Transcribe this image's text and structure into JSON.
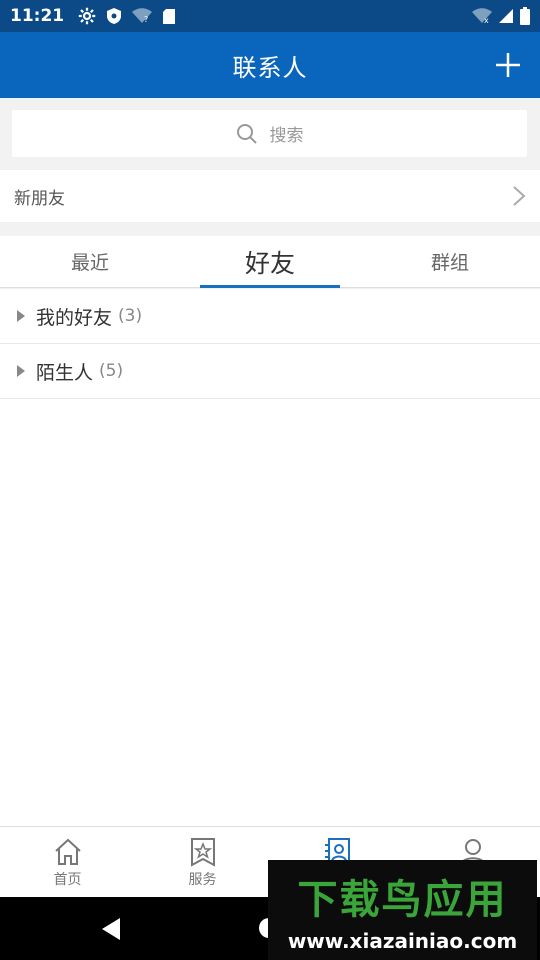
{
  "status_bar": {
    "time": "11:21"
  },
  "app_bar": {
    "title": "联系人"
  },
  "search": {
    "placeholder": "搜索"
  },
  "new_friends": {
    "label": "新朋友"
  },
  "tabs": [
    {
      "label": "最近"
    },
    {
      "label": "好友"
    },
    {
      "label": "群组"
    }
  ],
  "groups": [
    {
      "name": "我的好友",
      "count": "(3)"
    },
    {
      "name": "陌生人",
      "count": "(5)"
    }
  ],
  "bottom_nav": [
    {
      "label": "首页"
    },
    {
      "label": "服务"
    },
    {
      "label": ""
    },
    {
      "label": ""
    }
  ],
  "watermark": {
    "logo": "下载鸟应用",
    "url": "www.xiazainiao.com"
  },
  "colors": {
    "app_bar": "#0a66bd",
    "status_bar": "#0b4a86",
    "accent": "#1b6fbf"
  }
}
